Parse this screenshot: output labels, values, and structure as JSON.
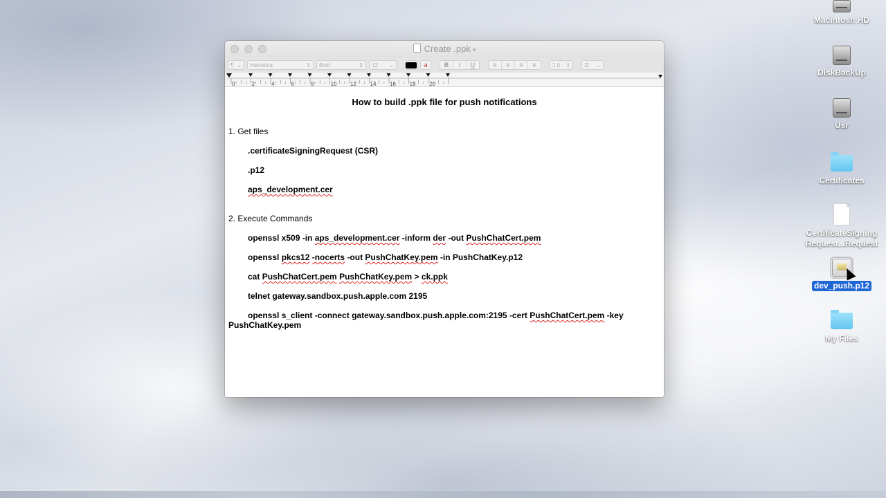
{
  "window": {
    "title": "Create .ppk",
    "toolbar": {
      "paragraph_style": "¶",
      "font_family": "Helvetica",
      "font_style": "Bold",
      "font_size": "12",
      "text_color": "#000000",
      "bold_label": "B",
      "italic_label": "I",
      "underline_label": "U",
      "line_spacing": "1.0"
    },
    "ruler": {
      "numbers": [
        "0",
        "2",
        "4",
        "6",
        "8",
        "10",
        "12",
        "14",
        "16",
        "18",
        "20"
      ]
    }
  },
  "document": {
    "title": "How to build .ppk file for push notifications",
    "section1": {
      "heading": "1. Get files",
      "items": [
        ".certificateSigningRequest (CSR)",
        ".p12",
        "aps_development.cer"
      ]
    },
    "section2": {
      "heading": "2. Execute Commands",
      "cmd1": {
        "a": "openssl x509 -in ",
        "b": "aps_development.cer",
        "c": " -inform ",
        "d": "der",
        "e": " -out ",
        "f": "PushChatCert.pem"
      },
      "cmd2": {
        "a": "openssl ",
        "b": "pkcs12",
        "c": " ",
        "d": "-nocerts",
        "e": " -out ",
        "f": "PushChatKey.pem",
        "g": " -in PushChatKey.p12"
      },
      "cmd3": {
        "a": "cat ",
        "b": "PushChatCert.pem",
        "c": " ",
        "d": "PushChatKey.pem",
        "e": " > ",
        "f": "ck.ppk"
      },
      "cmd4": "telnet gateway.sandbox.push.apple.com 2195",
      "cmd5": {
        "a": "openssl ",
        "b": "s_client",
        "c": " -connect gateway.sandbox.push.apple.com:2195 -cert ",
        "d": "PushChatCert.pem",
        "e": " -key",
        "f": "PushChatKey.pem"
      }
    }
  },
  "desktop": {
    "icons": [
      {
        "label": "Macintosh HD",
        "icon": "hard-drive-icon"
      },
      {
        "label": "DiskBackUp",
        "icon": "hard-drive-icon"
      },
      {
        "label": "Usr",
        "icon": "hard-drive-icon"
      },
      {
        "label": "Certificates",
        "icon": "folder-icon"
      },
      {
        "label1": "CertificateSigning",
        "label2": "Request...Request",
        "icon": "document-icon"
      },
      {
        "label": "dev_push.p12",
        "icon": "certificate-file-icon",
        "selected": true
      },
      {
        "label": "My Files",
        "icon": "folder-icon"
      }
    ]
  },
  "colors": {
    "selection": "#1f66d6",
    "folder": "#62c6f2",
    "spellcheck": "#e02424"
  }
}
